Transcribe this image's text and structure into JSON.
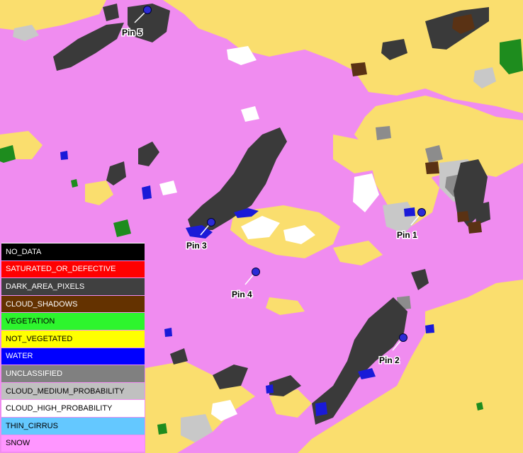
{
  "map": {
    "colors": {
      "snow": "#f08cf0",
      "not_vegetated": "#fade6e",
      "dark_area_pixels": "#3a3a3a",
      "water": "#1a1ad8",
      "cloud_high": "#ffffff",
      "cloud_medium": "#c8c8c8",
      "unclassified": "#8c8c8c",
      "vegetation": "#1e8c1e",
      "cloud_shadows": "#5a3214"
    },
    "pins": [
      {
        "label": "Pin 5",
        "color": "#2b2bd6"
      },
      {
        "label": "Pin 1",
        "color": "#2b2bd6"
      },
      {
        "label": "Pin 3",
        "color": "#2b2bd6"
      },
      {
        "label": "Pin 4",
        "color": "#2b2bd6"
      },
      {
        "label": "Pin 2",
        "color": "#2b2bd6"
      }
    ]
  },
  "legend": [
    {
      "label": "NO_DATA",
      "color": "#000000",
      "text_color": "#ffffff"
    },
    {
      "label": "SATURATED_OR_DEFECTIVE",
      "color": "#ff0000",
      "text_color": "#ffffff"
    },
    {
      "label": "DARK_AREA_PIXELS",
      "color": "#404040",
      "text_color": "#ffffff"
    },
    {
      "label": "CLOUD_SHADOWS",
      "color": "#643200",
      "text_color": "#ffffff"
    },
    {
      "label": "VEGETATION",
      "color": "#2df52d",
      "text_color": "#000000"
    },
    {
      "label": "NOT_VEGETATED",
      "color": "#ffff00",
      "text_color": "#000000"
    },
    {
      "label": "WATER",
      "color": "#0000ff",
      "text_color": "#ffffff"
    },
    {
      "label": "UNCLASSIFIED",
      "color": "#808080",
      "text_color": "#ffffff"
    },
    {
      "label": "CLOUD_MEDIUM_PROBABILITY",
      "color": "#c0c0c0",
      "text_color": "#000000"
    },
    {
      "label": "CLOUD_HIGH_PROBABILITY",
      "color": "#ffffff",
      "text_color": "#000000"
    },
    {
      "label": "THIN_CIRRUS",
      "color": "#64c8ff",
      "text_color": "#000000"
    },
    {
      "label": "SNOW",
      "color": "#ff96ff",
      "text_color": "#000000"
    }
  ]
}
